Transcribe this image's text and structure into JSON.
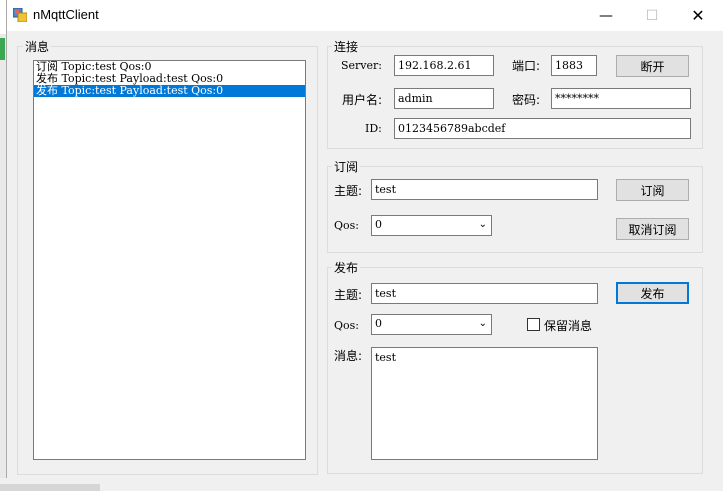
{
  "window": {
    "title": "nMqttClient",
    "minimize": "—",
    "maximize": "☐",
    "close": "✕"
  },
  "messages": {
    "group_label": "消息",
    "items": [
      "订阅 Topic:test Qos:0",
      "发布 Topic:test Payload:test Qos:0",
      "发布 Topic:test Payload:test Qos:0"
    ],
    "selected_index": 2
  },
  "connection": {
    "group_label": "连接",
    "server_label": "Server:",
    "server_value": "192.168.2.61",
    "port_label": "端口:",
    "port_value": "1883",
    "disconnect_label": "断开",
    "username_label": "用户名:",
    "username_value": "admin",
    "password_label": "密码:",
    "password_value": "********",
    "id_label": "ID:",
    "id_value": "0123456789abcdef"
  },
  "subscribe": {
    "group_label": "订阅",
    "topic_label": "主题:",
    "topic_value": "test",
    "subscribe_label": "订阅",
    "qos_label": "Qos:",
    "qos_value": "0",
    "unsubscribe_label": "取消订阅"
  },
  "publish": {
    "group_label": "发布",
    "topic_label": "主题:",
    "topic_value": "test",
    "publish_label": "发布",
    "qos_label": "Qos:",
    "qos_value": "0",
    "retain_label": "保留消息",
    "retain_checked": false,
    "message_label": "消息:",
    "message_value": "test"
  },
  "colors": {
    "selection": "#0078d7",
    "window_bg": "#f0f0f0"
  }
}
